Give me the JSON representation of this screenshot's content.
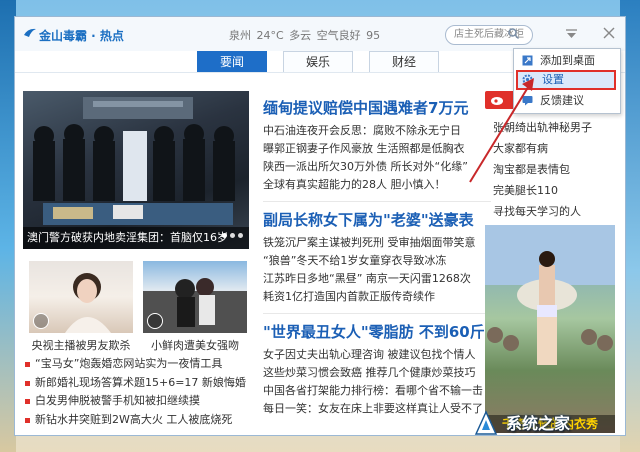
{
  "header": {
    "logo": "金山毒霸 · 热点",
    "weather": "泉州 24°C 多云 空气良好 95",
    "search_placeholder": "店主死后藏冰柜"
  },
  "tabs": [
    {
      "label": "要闻",
      "active": true
    },
    {
      "label": "娱乐",
      "active": false
    },
    {
      "label": "财经",
      "active": false
    }
  ],
  "featured": {
    "caption": "澳门警方破获内地卖淫集团：首脑仅16岁"
  },
  "stories": [
    {
      "headline": "缅甸提议赔偿中国遇难者7万元",
      "items": [
        "中石油连夜开会反思：腐败不除永无宁日",
        "曝郭正钢妻子作风豪放 生活照都是低胸衣",
        "陕西一派出所欠30万外债 所长对外“化缘”",
        "全球有真实超能力的28人 胆小慎入！"
      ]
    },
    {
      "headline": "副局长称女下属为\"老婆\"送豪表",
      "items": [
        "铁笼沉尸案主谋被判死刑 受审抽烟面带笑意",
        "“狼兽”冬天不给1岁女童穿衣导致冰冻",
        "江苏昨日多地“黑昼” 南京一天闪雷1268次",
        "耗资1亿打造国内首款正版传奇续作"
      ]
    },
    {
      "headline": "\"世界最丑女人\"零脂肪 不到60斤",
      "items": [
        "女子因丈夫出轨心理咨询 被建议包找个情人",
        "这些炒菜习惯会致癌 推荐几个健康炒菜技巧",
        "中国各省打架能力排行榜：看哪个省不输一击",
        "每日一笑：女友在床上非要这样真让人受不了"
      ]
    }
  ],
  "thumbs": [
    {
      "caption": "央视主播被男友欺杀"
    },
    {
      "caption": "小鲜肉遭美女强吻"
    }
  ],
  "news_list": [
    "“宝马女”炮轰婚恋网站实为一夜情工具",
    "新郎婚礼现场答算术题15+6=17 新娘悔婚",
    "白发男伸脱被警手机知被扣继续摸",
    "新钻水井突赃到2W高大火 工人被底烧死"
  ],
  "sidebar": {
    "items": [
      "张朝绮出轨神秘男子",
      "大家都有病",
      "淘宝都是表情包",
      "完美腿长110",
      "寻找每天学习的人"
    ],
    "image_caption": "千奇百怪的内衣秀"
  },
  "context_menu": {
    "items": [
      {
        "label": "添加到桌面",
        "icon": "desktop-add-icon"
      },
      {
        "label": "设置",
        "icon": "gear-icon",
        "selected": true
      },
      {
        "label": "反馈建议",
        "icon": "feedback-icon"
      }
    ]
  },
  "watermark": {
    "text": "系统之家"
  },
  "colors": {
    "accent": "#1e6ec8",
    "highlight": "#e0302a",
    "headline": "#1b5fb5"
  }
}
